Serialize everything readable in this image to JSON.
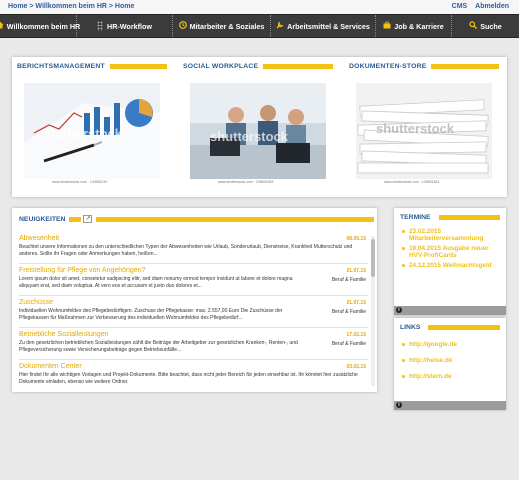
{
  "breadcrumb": {
    "text": "Home > Willkommen beim HR > Home"
  },
  "topbar": {
    "cms": "CMS",
    "logout": "Abmelden"
  },
  "nav": {
    "items": [
      {
        "label": "Willkommen beim HR",
        "icon": "home-icon"
      },
      {
        "label": "HR-Workflow",
        "icon": "dots-icon"
      },
      {
        "label": "Mitarbeiter & Soziales",
        "icon": "clock-icon"
      },
      {
        "label": "Arbeitsmittel & Services",
        "icon": "wrench-icon"
      },
      {
        "label": "Job & Karriere",
        "icon": "briefcase-icon"
      },
      {
        "label": "Suche",
        "icon": "search-icon"
      }
    ]
  },
  "featured": [
    {
      "title": "BERICHTSMANAGEMENT",
      "credit": "www.shutterstock.com · 133962149"
    },
    {
      "title": "SOCIAL WORKPLACE",
      "credit": "www.shutterstock.com · 208639283"
    },
    {
      "title": "DOKUMENTEN-STORE",
      "credit": "www.shutterstock.com · 125691824"
    }
  ],
  "watermark": "shutterstock",
  "news": {
    "title": "NEUIGKEITEN",
    "items": [
      {
        "title": "Abwesenheit",
        "date": "08.09.15",
        "category": "",
        "text": "Beachtet unsere Informationen zu den unterschiedlichen Typen der Abwesenheiten wie Urlaub, Sonderurlaub, Dienstreise, Krankheit Mutterschutz und anderes. Sollte ihr Fragen oder Anmerkungen haben, heißen..."
      },
      {
        "title": "Freistellung für Pflege von Angehörigen?",
        "date": "21.07.15",
        "category": "Beruf & Familie",
        "text": "Lorem ipsum dolor sit amet, consetetur sadipscing elitr, sed diam nonumy eirmod tempor invidunt ut labore et dolore magna aliquyam erat, sed diam voluptua. At vero eos et accusam et justo duo dolores et..."
      },
      {
        "title": "Zuschüsse",
        "date": "21.07.15",
        "category": "Beruf & Familie",
        "text": "Individuellen Wohnumfeldes des Pflegebedürftigen. Zuschuss der Pflegekasse: max. 2.557,00 Euro Die Zuschüsse der Pflegekassen für Maßnahmen zur Verbesserung des individuellen Wohnumfeldes des Pflegebedürf..."
      },
      {
        "title": "Betriebliche Sozialleistungen",
        "date": "17.02.15",
        "category": "Beruf & Familie",
        "text": "Zu den gesetzlichen betrieblichen Sozialleistungen zählt die Beiträge der Arbeitgeber zur gesetzlichen Kranken-, Renten-, und Pflegeversicherung sowie Versicherungsbeiträge gegen Betriebsunfälle..."
      },
      {
        "title": "Dokumenten Center",
        "date": "03.02.15",
        "category": "",
        "text": "Hier findet Ihr alle wichtigen Vorlagen und Projekt-Dokumente. Bitte beachtet, dass nicht jeder Bereich für jeden einsehbar ist. Ihr könntet hier zusätzliche Dokumente einladen, ebenso wie weitere Ordner."
      }
    ]
  },
  "termine": {
    "title": "TERMINE",
    "items": [
      {
        "text": "23.02.2015 Mitarbeiterversammlung"
      },
      {
        "text": "19.04.2015 Ausgabe neuer HVV-ProfiCards"
      },
      {
        "text": "24.12.2015 Weihnachtsgeld"
      }
    ]
  },
  "links": {
    "title": "LINKS",
    "items": [
      {
        "text": "http://google.de"
      },
      {
        "text": "http://heise.de"
      },
      {
        "text": "http://stern.de"
      }
    ]
  },
  "colors": {
    "accent": "#f3c10f",
    "heading": "#2c5a93",
    "nav": "#3b3b3b",
    "link": "#2f5e9a"
  }
}
